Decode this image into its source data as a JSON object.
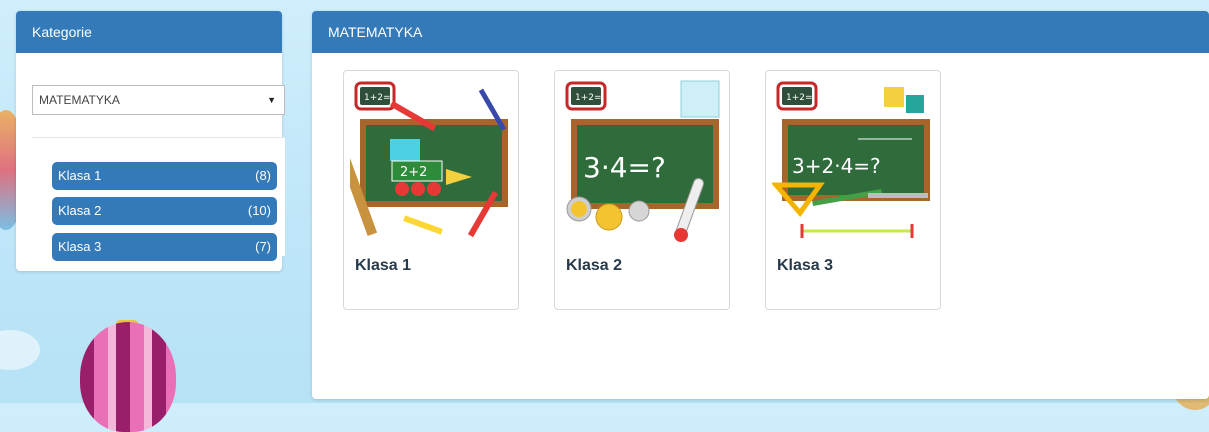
{
  "sidebar": {
    "title": "Kategorie",
    "select_value": "MATEMATYKA",
    "categories": [
      {
        "label": "Klasa 1",
        "count": "(8)"
      },
      {
        "label": "Klasa 2",
        "count": "(10)"
      },
      {
        "label": "Klasa 3",
        "count": "(7)"
      }
    ]
  },
  "main": {
    "title": "MATEMATYKA",
    "cards": [
      {
        "title": "Klasa 1",
        "board_text": "2+2",
        "badge": "1+2="
      },
      {
        "title": "Klasa 2",
        "board_text": "3·4=?",
        "badge": "1+2="
      },
      {
        "title": "Klasa 3",
        "board_text": "3+2·4=?",
        "badge": "1+2="
      }
    ]
  },
  "colors": {
    "accent": "#3479b8",
    "board": "#2f6b3b",
    "frame": "#a7652b"
  }
}
